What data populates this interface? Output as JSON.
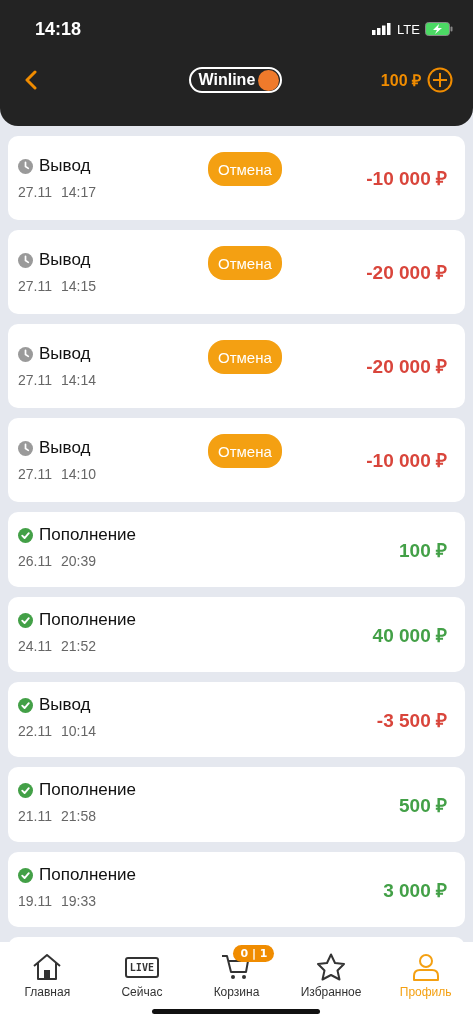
{
  "status_bar": {
    "time": "14:18",
    "network": "LTE"
  },
  "header": {
    "logo": "Winline",
    "balance": "100 ₽"
  },
  "transactions": [
    {
      "title": "Вывод",
      "kind": "pending",
      "color": "#d9453b",
      "date": "27.11",
      "time": "14:17",
      "amount": "-10 000 ₽",
      "action": "Отмена"
    },
    {
      "title": "Вывод",
      "kind": "pending",
      "color": "#d9453b",
      "date": "27.11",
      "time": "14:15",
      "amount": "-20 000 ₽",
      "action": "Отмена"
    },
    {
      "title": "Вывод",
      "kind": "pending",
      "color": "#d9453b",
      "date": "27.11",
      "time": "14:14",
      "amount": "-20 000 ₽",
      "action": "Отмена"
    },
    {
      "title": "Вывод",
      "kind": "pending",
      "color": "#d9453b",
      "date": "27.11",
      "time": "14:10",
      "amount": "-10 000 ₽",
      "action": "Отмена"
    },
    {
      "title": "Пополнение",
      "kind": "done",
      "color": "#43a047",
      "date": "26.11",
      "time": "20:39",
      "amount": "100 ₽"
    },
    {
      "title": "Пополнение",
      "kind": "done",
      "color": "#43a047",
      "date": "24.11",
      "time": "21:52",
      "amount": "40 000 ₽"
    },
    {
      "title": "Вывод",
      "kind": "done",
      "color": "#d9453b",
      "date": "22.11",
      "time": "10:14",
      "amount": "-3 500 ₽"
    },
    {
      "title": "Пополнение",
      "kind": "done",
      "color": "#43a047",
      "date": "21.11",
      "time": "21:58",
      "amount": "500 ₽"
    },
    {
      "title": "Пополнение",
      "kind": "done",
      "color": "#43a047",
      "date": "19.11",
      "time": "19:33",
      "amount": "3 000 ₽"
    }
  ],
  "tab_bar": [
    {
      "label": "Главная",
      "kind": "home",
      "selected": false
    },
    {
      "label": "Сейчас",
      "kind": "live",
      "icon_text": "LIVE",
      "selected": false
    },
    {
      "label": "Корзина",
      "kind": "cart",
      "badge": "0 | 1",
      "selected": false
    },
    {
      "label": "Избранное",
      "kind": "star",
      "selected": false
    },
    {
      "label": "Профиль",
      "kind": "profile",
      "selected": true
    }
  ]
}
